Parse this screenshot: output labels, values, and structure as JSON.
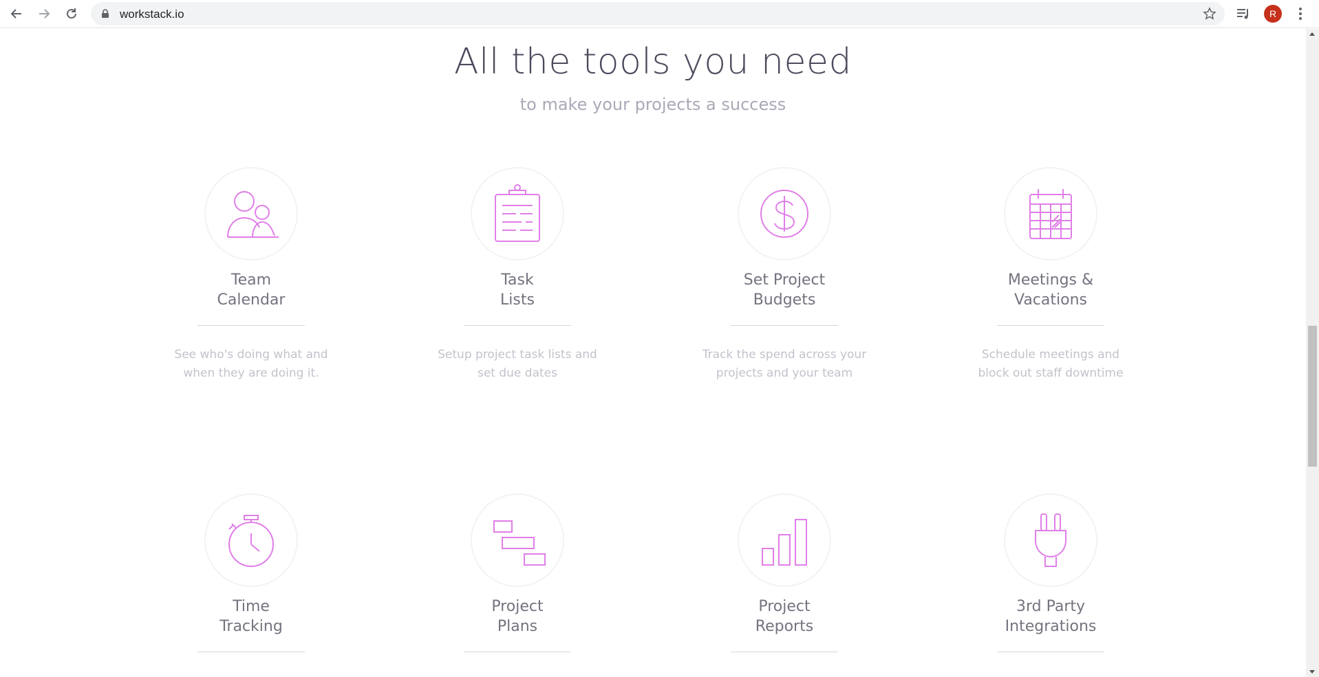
{
  "browser": {
    "url": "workstack.io",
    "profile_initial": "R",
    "icons": [
      "back-arrow-icon",
      "forward-arrow-icon",
      "reload-icon",
      "lock-icon",
      "star-icon",
      "media-control-icon",
      "menu-dots-icon"
    ]
  },
  "page": {
    "heading": "All the tools you need",
    "subheading": "to make your projects a success",
    "accent_color": "#e07ee8",
    "features": [
      {
        "icon": "team-people-icon",
        "title": "Team\nCalendar",
        "description": "See who's doing what and\nwhen they are doing it."
      },
      {
        "icon": "clipboard-list-icon",
        "title": "Task\nLists",
        "description": "Setup project task lists and\nset due dates"
      },
      {
        "icon": "dollar-coin-icon",
        "title": "Set Project\nBudgets",
        "description": "Track the spend across your\nprojects and your team"
      },
      {
        "icon": "calendar-grid-icon",
        "title": "Meetings &\nVacations",
        "description": "Schedule meetings and\nblock out staff downtime"
      },
      {
        "icon": "stopwatch-icon",
        "title": "Time\nTracking",
        "description": ""
      },
      {
        "icon": "gantt-plan-icon",
        "title": "Project\nPlans",
        "description": ""
      },
      {
        "icon": "bar-chart-icon",
        "title": "Project\nReports",
        "description": ""
      },
      {
        "icon": "plug-icon",
        "title": "3rd Party\nIntegrations",
        "description": ""
      }
    ]
  }
}
